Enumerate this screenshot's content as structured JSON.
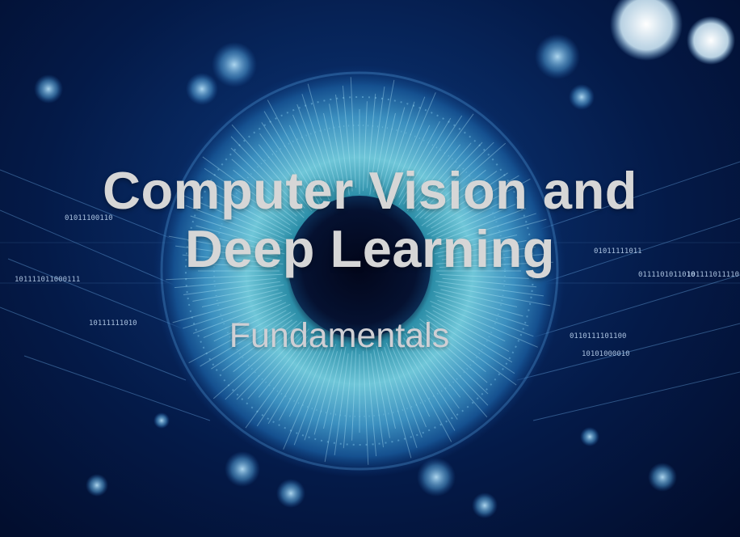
{
  "slide": {
    "title_line_1": "Computer Vision and",
    "title_line_2": "Deep Learning",
    "subtitle": "Fundamentals"
  },
  "background": {
    "description_icon": "digital-eye-iris-icon",
    "binary_strings": [
      "01011100110",
      "101111011000111",
      "10111111010",
      "01011111011",
      "0111101011010",
      "101111011110",
      "10101000010",
      "0110111101100"
    ]
  },
  "colors": {
    "background_deep": "#031033",
    "background_mid": "#0e3f7e",
    "iris": "#7fd4e8",
    "title_text": "#d6d6d6"
  }
}
